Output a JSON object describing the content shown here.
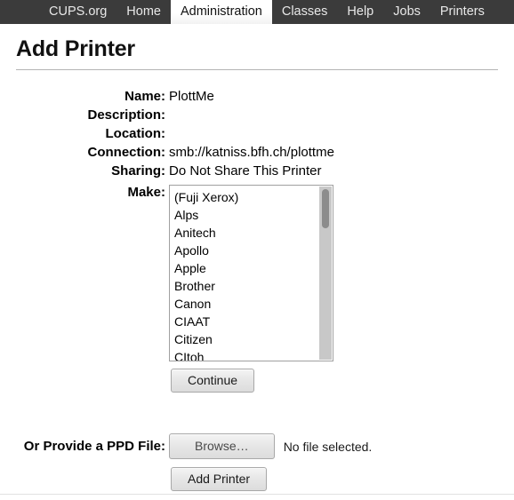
{
  "nav": {
    "tabs": [
      {
        "label": "CUPS.org",
        "active": false
      },
      {
        "label": "Home",
        "active": false
      },
      {
        "label": "Administration",
        "active": true
      },
      {
        "label": "Classes",
        "active": false
      },
      {
        "label": "Help",
        "active": false
      },
      {
        "label": "Jobs",
        "active": false
      },
      {
        "label": "Printers",
        "active": false
      }
    ]
  },
  "page": {
    "title": "Add Printer"
  },
  "form": {
    "fields": [
      {
        "label": "Name:",
        "value": "PlottMe"
      },
      {
        "label": "Description:",
        "value": ""
      },
      {
        "label": "Location:",
        "value": ""
      },
      {
        "label": "Connection:",
        "value": "smb://katniss.bfh.ch/plottme"
      },
      {
        "label": "Sharing:",
        "value": "Do Not Share This Printer"
      }
    ],
    "make": {
      "label": "Make:",
      "options": [
        "(Fuji Xerox)",
        "Alps",
        "Anitech",
        "Apollo",
        "Apple",
        "Brother",
        "Canon",
        "CIAAT",
        "Citizen",
        "CItoh"
      ],
      "selected": ""
    },
    "continue_label": "Continue"
  },
  "ppd": {
    "label": "Or Provide a PPD File:",
    "browse_label": "Browse…",
    "status": "No file selected.",
    "submit_label": "Add Printer"
  },
  "colors": {
    "navbar_bg": "#3b3b3b",
    "navbar_text": "#e8e8e8",
    "active_tab_bg": "#ffffff",
    "active_tab_text": "#111111",
    "page_bg": "#ffffff",
    "rule": "#b4b4b4",
    "listbox_border": "#a0a0a0",
    "scroll_track": "#c8c8c8",
    "scroll_thumb": "#8c8c8c",
    "button_face": "#e6e6e6"
  }
}
